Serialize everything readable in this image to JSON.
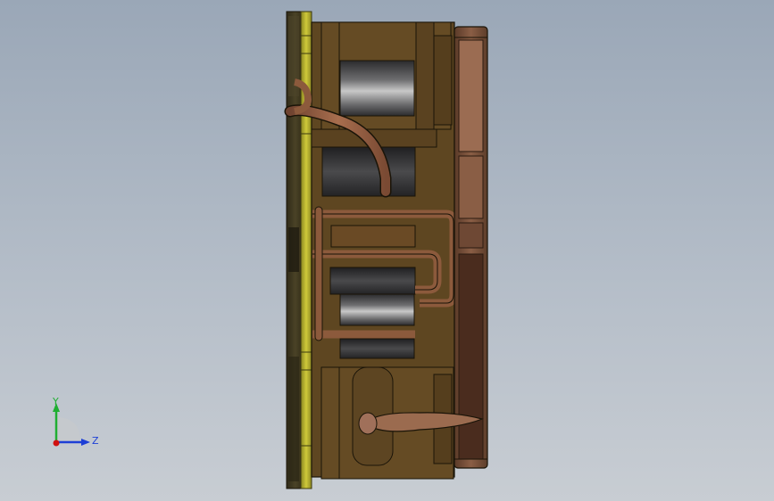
{
  "viewport": {
    "background_top": "#9aa7b7",
    "background_bottom": "#c8cdd3"
  },
  "model": {
    "description_icon": "cad-section-view",
    "colors": {
      "plate_dark": "#3f3a23",
      "plate_olive": "#b9b42a",
      "body_brown": "#5e4621",
      "body_brown_dark": "#4a3618",
      "copper": "#8c5a3c",
      "copper_light": "#b07a56",
      "steel_dark": "#2e2e30",
      "steel_light": "#9a9a9a",
      "edge": "#1a1408"
    }
  },
  "triad": {
    "y_label": "Y",
    "z_label": "Z",
    "y_color": "#1fae32",
    "z_color": "#1d3fd6",
    "origin_color": "#d01010"
  }
}
